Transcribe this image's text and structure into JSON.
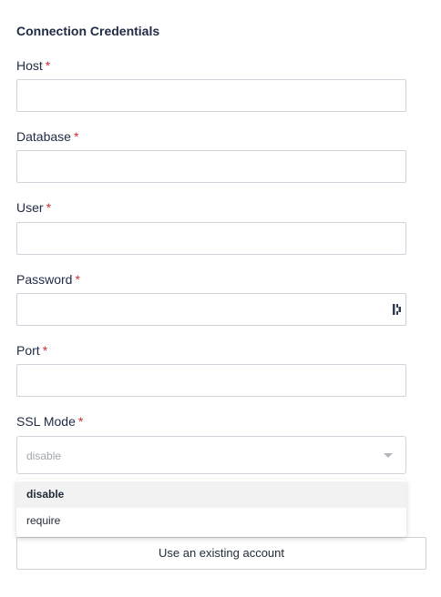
{
  "section": {
    "title": "Connection Credentials"
  },
  "required_marker": "*",
  "fields": {
    "host": {
      "label": "Host",
      "value": ""
    },
    "database": {
      "label": "Database",
      "value": ""
    },
    "user": {
      "label": "User",
      "value": ""
    },
    "password": {
      "label": "Password",
      "value": "",
      "icon": "password-manager-icon"
    },
    "port": {
      "label": "Port",
      "value": ""
    }
  },
  "ssl_mode": {
    "label": "SSL Mode",
    "selected": "disable",
    "options": [
      "disable",
      "require"
    ]
  },
  "account_button": {
    "label": "Use an existing account"
  },
  "colors": {
    "required": "#d32f2f",
    "border": "#cfd4dc",
    "selected_bg": "#f2f2f2"
  }
}
